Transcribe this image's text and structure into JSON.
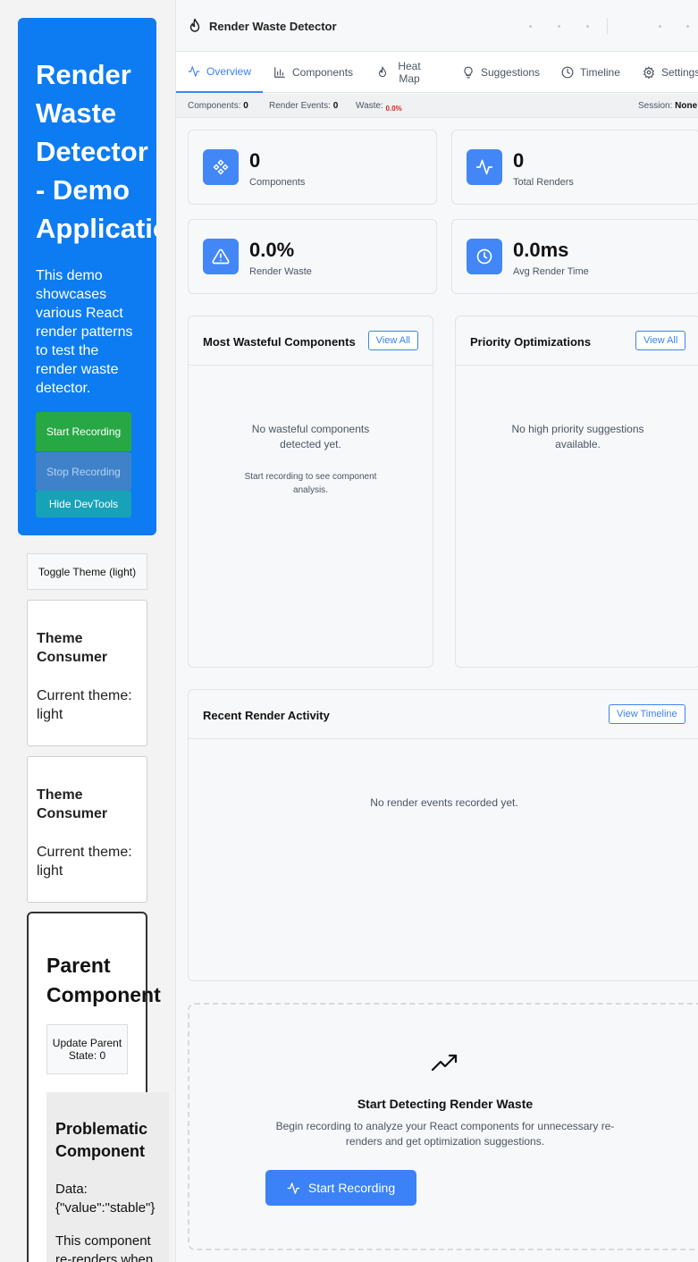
{
  "demo": {
    "hero_title": "Render\nWaste\nDetector\n- Demo\nApplication",
    "hero_description": "This demo showcases various React render patterns to test the render waste detector.",
    "buttons": {
      "start_recording": "Start Recording",
      "stop_recording": "Stop Recording",
      "hide_devtools": "Hide DevTools",
      "toggle_theme": "Toggle Theme (light)"
    },
    "theme_consumers": [
      {
        "title": "Theme Consumer",
        "text": "Current theme: light"
      },
      {
        "title": "Theme Consumer",
        "text": "Current theme: light"
      }
    ],
    "parent": {
      "title": "Parent\nComponent",
      "update_button": "Update Parent State: 0"
    },
    "problematic": {
      "title": "Problematic\nComponent",
      "data_text": "Data: {\"value\":\"stable\"}",
      "description": "This component re-renders when"
    }
  },
  "devtools": {
    "title": "Render Waste Detector",
    "tabs": [
      {
        "label": "Overview",
        "icon": "activity-icon"
      },
      {
        "label": "Components",
        "icon": "bar-chart-icon"
      },
      {
        "label": "Heat Map",
        "icon": "flame-icon"
      },
      {
        "label": "Suggestions",
        "icon": "lightbulb-icon"
      },
      {
        "label": "Timeline",
        "icon": "clock-icon"
      },
      {
        "label": "Settings",
        "icon": "gear-icon"
      }
    ],
    "status": {
      "components_label": "Components:",
      "components_value": "0",
      "render_events_label": "Render Events:",
      "render_events_value": "0",
      "waste_label": "Waste:",
      "waste_value": "0.0%",
      "session_label": "Session:",
      "session_value": "None"
    },
    "stats": [
      {
        "value": "0",
        "label": "Components",
        "icon": "components-icon"
      },
      {
        "value": "0",
        "label": "Total Renders",
        "icon": "activity-icon"
      },
      {
        "value": "0.0%",
        "label": "Render Waste",
        "icon": "alert-triangle-icon"
      },
      {
        "value": "0.0ms",
        "label": "Avg Render Time",
        "icon": "clock-icon"
      }
    ],
    "wasteful": {
      "title": "Most Wasteful Components",
      "button": "View All",
      "empty": "No wasteful components detected yet.",
      "hint": "Start recording to see component analysis."
    },
    "priority": {
      "title": "Priority Optimizations",
      "button": "View All",
      "empty": "No high priority suggestions available."
    },
    "recent": {
      "title": "Recent Render Activity",
      "button": "View Timeline",
      "empty": "No render events recorded yet."
    },
    "cta": {
      "title": "Start Detecting Render Waste",
      "description": "Begin recording to analyze your React components for unnecessary re-renders and get optimization suggestions.",
      "button": "Start Recording"
    },
    "colors": {
      "accent": "#3b82f6",
      "hero_blue": "#0d7cf2",
      "start_green": "#28a745",
      "info_teal": "#17a2b8"
    }
  }
}
